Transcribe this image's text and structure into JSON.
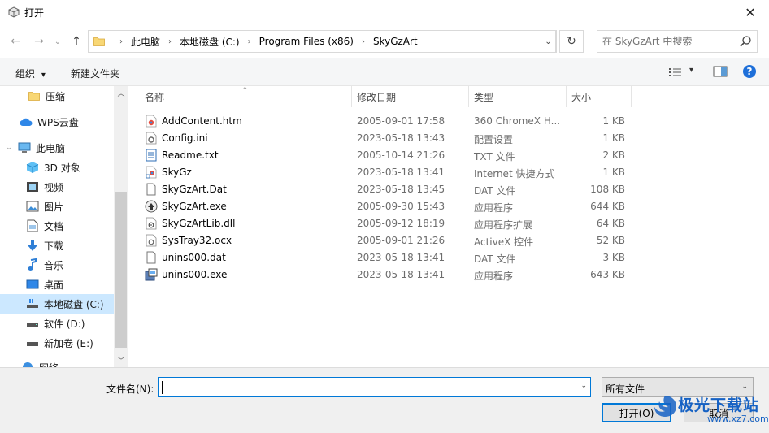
{
  "window": {
    "title": "打开",
    "close_glyph": "✕"
  },
  "nav": {
    "back_glyph": "←",
    "forward_glyph": "→",
    "recent_glyph": "⌄",
    "up_glyph": "↑",
    "breadcrumbs": [
      "此电脑",
      "本地磁盘 (C:)",
      "Program Files (x86)",
      "SkyGzArt"
    ],
    "dropdown_glyph": "⌄",
    "refresh_glyph": "↻",
    "search_placeholder": "在 SkyGzArt 中搜索"
  },
  "toolbar": {
    "organize_label": "组织",
    "organize_glyph": "▾",
    "new_folder_label": "新建文件夹",
    "view_glyph": "▾",
    "help_glyph": "?"
  },
  "sidebar": {
    "items": [
      {
        "label": "压缩",
        "icon": "folder-icon"
      },
      {
        "label": "WPS云盘",
        "icon": "cloud-icon"
      },
      {
        "label": "此电脑",
        "icon": "computer-icon",
        "expander": "⌄"
      },
      {
        "label": "3D 对象",
        "icon": "cube-icon"
      },
      {
        "label": "视频",
        "icon": "video-icon"
      },
      {
        "label": "图片",
        "icon": "picture-icon"
      },
      {
        "label": "文档",
        "icon": "document-icon"
      },
      {
        "label": "下载",
        "icon": "download-icon"
      },
      {
        "label": "音乐",
        "icon": "music-icon"
      },
      {
        "label": "桌面",
        "icon": "desktop-icon"
      },
      {
        "label": "本地磁盘 (C:)",
        "icon": "drive-icon",
        "selected": true
      },
      {
        "label": "软件 (D:)",
        "icon": "drive-icon"
      },
      {
        "label": "新加卷 (E:)",
        "icon": "drive-icon"
      },
      {
        "label": "网络",
        "icon": "network-icon"
      }
    ]
  },
  "columns": {
    "name": "名称",
    "date": "修改日期",
    "type": "类型",
    "size": "大小",
    "sort_glyph": "^"
  },
  "files": [
    {
      "name": "AddContent.htm",
      "date": "2005-09-01 17:58",
      "type": "360 ChromeX H...",
      "size": "1 KB",
      "icon": "html-icon"
    },
    {
      "name": "Config.ini",
      "date": "2023-05-18 13:43",
      "type": "配置设置",
      "size": "1 KB",
      "icon": "settings-file-icon"
    },
    {
      "name": "Readme.txt",
      "date": "2005-10-14 21:26",
      "type": "TXT 文件",
      "size": "2 KB",
      "icon": "text-file-icon"
    },
    {
      "name": "SkyGz",
      "date": "2023-05-18 13:41",
      "type": "Internet 快捷方式",
      "size": "1 KB",
      "icon": "shortcut-icon"
    },
    {
      "name": "SkyGzArt.Dat",
      "date": "2023-05-18 13:45",
      "type": "DAT 文件",
      "size": "108 KB",
      "icon": "blank-file-icon"
    },
    {
      "name": "SkyGzArt.exe",
      "date": "2005-09-30 15:43",
      "type": "应用程序",
      "size": "644 KB",
      "icon": "exe-icon"
    },
    {
      "name": "SkyGzArtLib.dll",
      "date": "2005-09-12 18:19",
      "type": "应用程序扩展",
      "size": "64 KB",
      "icon": "dll-icon"
    },
    {
      "name": "SysTray32.ocx",
      "date": "2005-09-01 21:26",
      "type": "ActiveX 控件",
      "size": "52 KB",
      "icon": "ocx-icon"
    },
    {
      "name": "unins000.dat",
      "date": "2023-05-18 13:41",
      "type": "DAT 文件",
      "size": "3 KB",
      "icon": "blank-file-icon"
    },
    {
      "name": "unins000.exe",
      "date": "2023-05-18 13:41",
      "type": "应用程序",
      "size": "643 KB",
      "icon": "installer-icon"
    }
  ],
  "bottom": {
    "filename_label": "文件名(N):",
    "filename_value": "",
    "filename_dropdown_glyph": "⌄",
    "filter_value": "所有文件",
    "filter_dropdown_glyph": "⌄",
    "open_label": "打开(O)",
    "cancel_label": "取消"
  },
  "watermark": {
    "text": "极光下载站",
    "url": "www.xz7.com"
  },
  "colors": {
    "accent": "#0078d7",
    "selected": "#cce8ff",
    "folder": "#f8d775"
  }
}
